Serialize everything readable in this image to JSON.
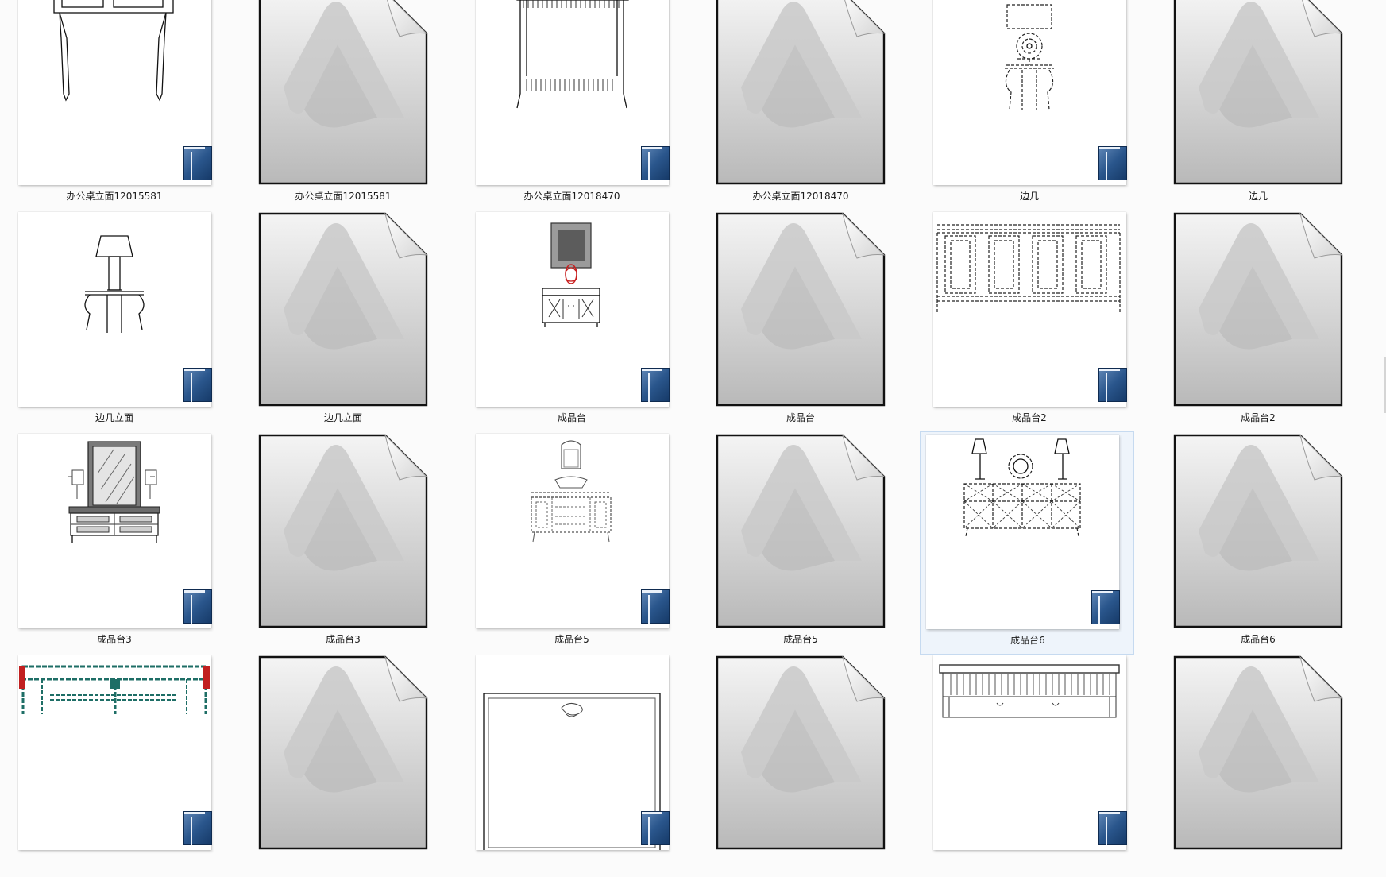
{
  "file_icon": "autocad-document-icon",
  "dwg_badge_icon": "dwg-badge-icon",
  "rows": [
    {
      "items": [
        {
          "label": "办公桌立面12015581",
          "kind": "thumb",
          "drawing": "desk-legs"
        },
        {
          "label": "办公桌立面12015581",
          "kind": "doc"
        },
        {
          "label": "办公桌立面12018470",
          "kind": "thumb",
          "drawing": "desk-fringe"
        },
        {
          "label": "办公桌立面12018470",
          "kind": "doc"
        },
        {
          "label": "边几",
          "kind": "thumb",
          "drawing": "side-table-clock"
        },
        {
          "label": "边几",
          "kind": "doc"
        }
      ]
    },
    {
      "items": [
        {
          "label": "边几立面",
          "kind": "thumb",
          "drawing": "lamp-table"
        },
        {
          "label": "边几立面",
          "kind": "doc"
        },
        {
          "label": "成品台",
          "kind": "thumb",
          "drawing": "cabinet-vase"
        },
        {
          "label": "成品台",
          "kind": "doc"
        },
        {
          "label": "成品台2",
          "kind": "thumb",
          "drawing": "sideboard-panels"
        },
        {
          "label": "成品台2",
          "kind": "doc"
        }
      ]
    },
    {
      "items": [
        {
          "label": "成品台3",
          "kind": "thumb",
          "drawing": "mirror-dresser"
        },
        {
          "label": "成品台3",
          "kind": "doc"
        },
        {
          "label": "成品台5",
          "kind": "thumb",
          "drawing": "console-mirror"
        },
        {
          "label": "成品台5",
          "kind": "doc"
        },
        {
          "label": "成品台6",
          "kind": "thumb",
          "drawing": "lattice-console",
          "selected": true
        },
        {
          "label": "成品台6",
          "kind": "doc"
        }
      ]
    },
    {
      "items": [
        {
          "label": "",
          "kind": "thumb",
          "drawing": "teal-frame"
        },
        {
          "label": "",
          "kind": "doc"
        },
        {
          "label": "",
          "kind": "thumb",
          "drawing": "plan-outline"
        },
        {
          "label": "",
          "kind": "doc"
        },
        {
          "label": "",
          "kind": "thumb",
          "drawing": "ornate-cabinet"
        },
        {
          "label": "",
          "kind": "doc"
        }
      ]
    }
  ]
}
